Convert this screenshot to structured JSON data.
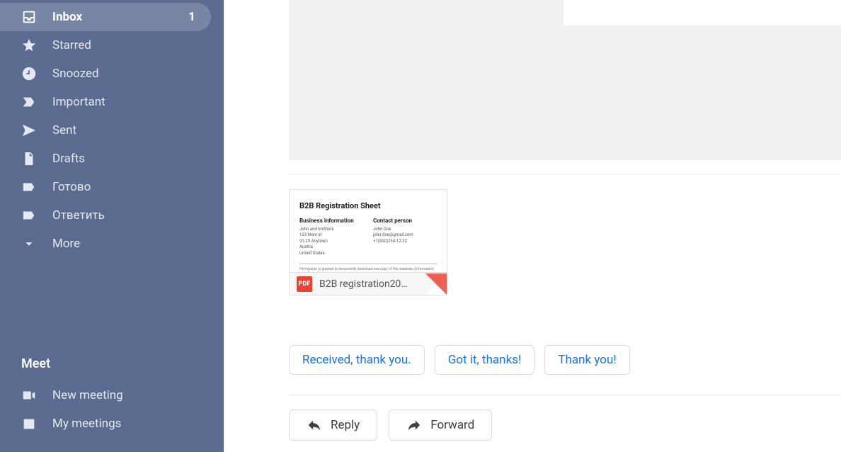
{
  "sidebar": {
    "items": [
      {
        "label": "Inbox",
        "badge": "1"
      },
      {
        "label": "Starred"
      },
      {
        "label": "Snoozed"
      },
      {
        "label": "Important"
      },
      {
        "label": "Sent"
      },
      {
        "label": "Drafts"
      },
      {
        "label": "Готово"
      },
      {
        "label": "Ответить"
      },
      {
        "label": "More"
      }
    ]
  },
  "meet": {
    "title": "Meet",
    "new_meeting": "New meeting",
    "my_meetings": "My meetings"
  },
  "attachment": {
    "preview": {
      "title": "B2B Registration Sheet",
      "biz_header": "Business information",
      "biz_line1": "John and brothers",
      "biz_line2": "123 Main st",
      "biz_line3": "91-29 Anytown",
      "biz_line4": "Austria",
      "biz_line5": "United States",
      "contact_header": "Contact person",
      "contact_line1": "John Doe",
      "contact_line2": "john.doe@gmail.com",
      "contact_line3": "+1(800)234-12-32",
      "fineprint": "Permission is granted to temporarily download one copy of the materials (information or software) on"
    },
    "pdf_label": "PDF",
    "filename": "B2B registration20…"
  },
  "smart_replies": [
    "Received, thank you.",
    "Got it, thanks!",
    "Thank you!"
  ],
  "actions": {
    "reply": "Reply",
    "forward": "Forward"
  }
}
